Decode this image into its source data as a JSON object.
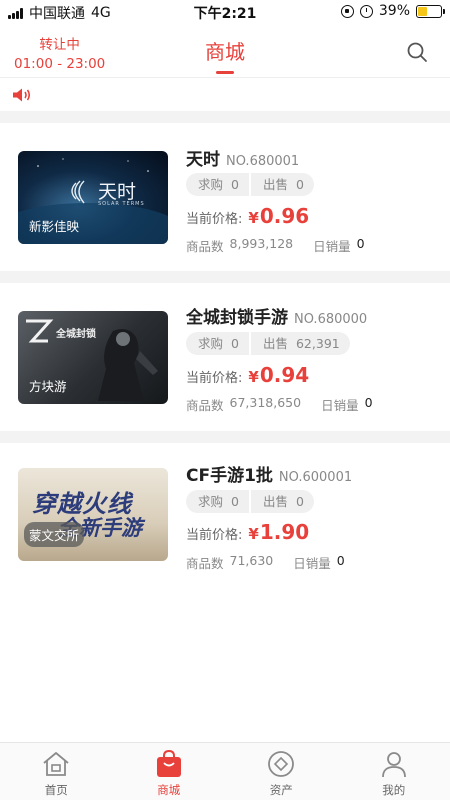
{
  "status_bar": {
    "carrier": "中国联通",
    "network": "4G",
    "time": "下午2:21",
    "battery_text": "39%",
    "battery_level": 0.39
  },
  "header": {
    "trade_status": "转让中",
    "trade_hours": "01:00 - 23:00",
    "title": "商城"
  },
  "products": [
    {
      "name": "天时",
      "no": "NO.680001",
      "thumb_tag": "新影佳映",
      "thumb_logo": "天时",
      "thumb_logo_sub": "SOLAR TERMS",
      "buy_label": "求购",
      "buy_count": "0",
      "sell_label": "出售",
      "sell_count": "0",
      "price_label": "当前价格:",
      "currency": "¥",
      "price": "0.96",
      "qty_label": "商品数",
      "qty": "8,993,128",
      "sales_label": "日销量",
      "sales": "0"
    },
    {
      "name": "全城封锁手游",
      "no": "NO.680000",
      "thumb_tag": "方块游",
      "thumb_logo": "全城封锁",
      "thumb_logo_sub": "",
      "buy_label": "求购",
      "buy_count": "0",
      "sell_label": "出售",
      "sell_count": "62,391",
      "price_label": "当前价格:",
      "currency": "¥",
      "price": "0.94",
      "qty_label": "商品数",
      "qty": "67,318,650",
      "sales_label": "日销量",
      "sales": "0"
    },
    {
      "name": "CF手游1批",
      "no": "NO.600001",
      "thumb_tag": "蒙文交所",
      "thumb_logo": "穿越火线",
      "thumb_logo_sub": "全新手游",
      "buy_label": "求购",
      "buy_count": "0",
      "sell_label": "出售",
      "sell_count": "0",
      "price_label": "当前价格:",
      "currency": "¥",
      "price": "1.90",
      "qty_label": "商品数",
      "qty": "71,630",
      "sales_label": "日销量",
      "sales": "0"
    }
  ],
  "tabbar": {
    "items": [
      {
        "label": "首页",
        "icon": "home-icon"
      },
      {
        "label": "商城",
        "icon": "shopping-bag-icon"
      },
      {
        "label": "资产",
        "icon": "asset-icon"
      },
      {
        "label": "我的",
        "icon": "user-icon"
      }
    ],
    "active_index": 1
  },
  "colors": {
    "accent": "#e8403a",
    "battery": "#f5c518"
  }
}
